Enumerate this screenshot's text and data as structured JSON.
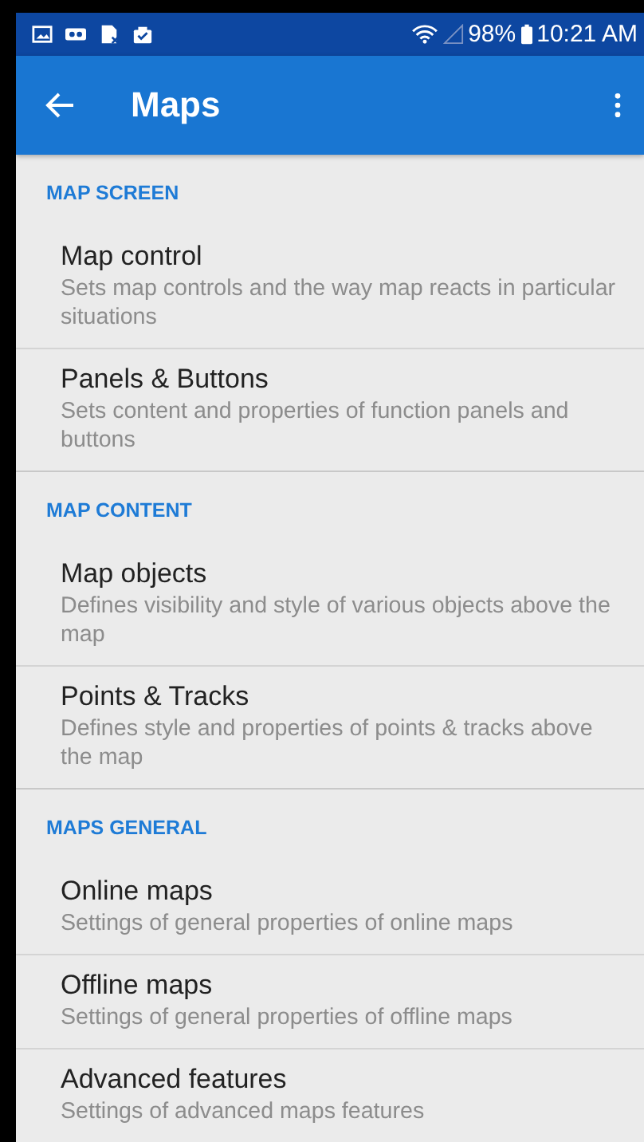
{
  "status_bar": {
    "battery": "98%",
    "time": "10:21 AM"
  },
  "app_bar": {
    "title": "Maps"
  },
  "sections": [
    {
      "header": "MAP SCREEN",
      "items": [
        {
          "title": "Map control",
          "summary": "Sets map controls and the way map reacts in particular situations"
        },
        {
          "title": "Panels & Buttons",
          "summary": "Sets content and properties of function panels and buttons"
        }
      ]
    },
    {
      "header": "MAP CONTENT",
      "items": [
        {
          "title": "Map objects",
          "summary": "Defines visibility and style of various objects above the map"
        },
        {
          "title": "Points & Tracks",
          "summary": "Defines style and properties of points & tracks above the map"
        }
      ]
    },
    {
      "header": "MAPS GENERAL",
      "items": [
        {
          "title": "Online maps",
          "summary": "Settings of general properties of online maps"
        },
        {
          "title": "Offline maps",
          "summary": "Settings of general properties of offline maps"
        },
        {
          "title": "Advanced features",
          "summary": "Settings of advanced maps features"
        }
      ]
    }
  ]
}
